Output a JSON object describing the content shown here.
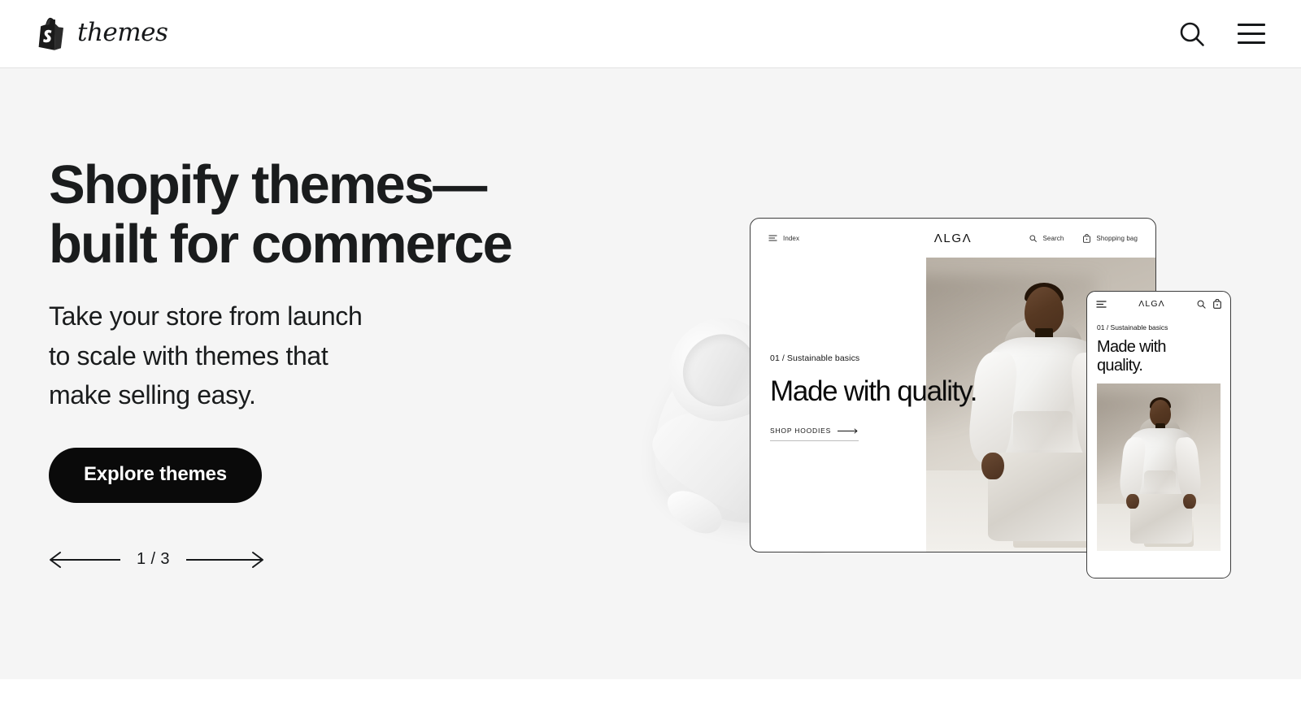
{
  "header": {
    "brand_word": "themes",
    "logo_icon": "shopify-bag-icon",
    "search_icon": "search-icon",
    "menu_icon": "hamburger-menu-icon",
    "divider_color": "#e3e3e3"
  },
  "hero": {
    "background_color": "#f5f5f5",
    "title": "Shopify themes—\nbuilt for commerce",
    "subtitle": "Take your store from launch\nto scale with themes that\nmake selling easy.",
    "cta_label": "Explore themes",
    "cta_background": "#0a0a0a",
    "cta_text_color": "#ffffff",
    "carousel": {
      "prev_icon": "arrow-left-icon",
      "next_icon": "arrow-right-icon",
      "counter": "1 / 3",
      "current": 1,
      "total": 3
    }
  },
  "mockups": {
    "desktop": {
      "nav_index_label": "Index",
      "nav_index_icon": "hamburger-menu-icon",
      "logo": "ΛLGΛ",
      "nav_search_label": "Search",
      "nav_search_icon": "search-icon",
      "nav_bag_label": "Shopping bag",
      "nav_bag_icon": "shopping-bag-icon",
      "eyebrow": "01 / Sustainable basics",
      "headline": "Made with quality.",
      "shop_link_label": "SHOP HOODIES",
      "shop_link_icon": "arrow-right-icon"
    },
    "mobile": {
      "nav_menu_icon": "hamburger-menu-icon",
      "logo": "ΛLGΛ",
      "nav_search_icon": "search-icon",
      "nav_bag_icon": "shopping-bag-icon",
      "eyebrow": "01 / Sustainable basics",
      "headline": "Made with\nquality."
    },
    "product_photo_alt": "white-hoodie-flatlay",
    "model_photo_alt": "model-wearing-white-hoodie"
  }
}
